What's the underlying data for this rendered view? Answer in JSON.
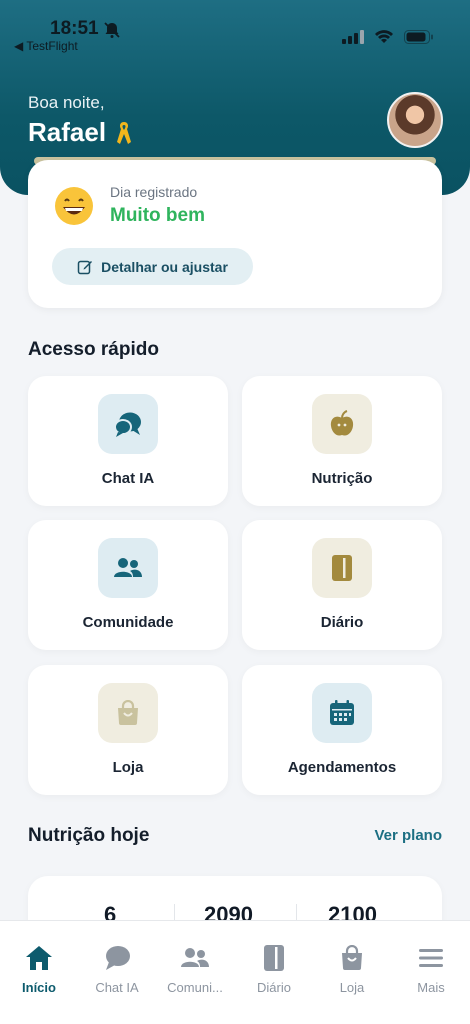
{
  "status_bar": {
    "time": "18:51",
    "back_app": "TestFlight"
  },
  "header": {
    "greeting": "Boa noite,",
    "name": "Rafael"
  },
  "mood": {
    "label": "Dia registrado",
    "value": "Muito bem",
    "adjust_button": "Detalhar ou ajustar"
  },
  "quick_access": {
    "title": "Acesso rápido",
    "items": [
      {
        "label": "Chat IA",
        "icon": "chat-icon"
      },
      {
        "label": "Nutrição",
        "icon": "apple-icon"
      },
      {
        "label": "Comunidade",
        "icon": "people-icon"
      },
      {
        "label": "Diário",
        "icon": "journal-icon"
      },
      {
        "label": "Loja",
        "icon": "shopping-bag-icon"
      },
      {
        "label": "Agendamentos",
        "icon": "calendar-icon"
      }
    ]
  },
  "nutrition": {
    "title": "Nutrição hoje",
    "link": "Ver plano",
    "values": [
      "6",
      "2090",
      "2100"
    ]
  },
  "tabbar": {
    "items": [
      {
        "label": "Início",
        "icon": "home-icon",
        "active": true
      },
      {
        "label": "Chat IA",
        "icon": "chat-icon"
      },
      {
        "label": "Comuni...",
        "icon": "people-icon"
      },
      {
        "label": "Diário",
        "icon": "journal-icon"
      },
      {
        "label": "Loja",
        "icon": "shopping-bag-icon"
      },
      {
        "label": "Mais",
        "icon": "menu-icon"
      }
    ]
  },
  "colors": {
    "primary": "#0d5b6d",
    "mood_green": "#2fb45d",
    "accent_beige": "#a38a3e"
  }
}
